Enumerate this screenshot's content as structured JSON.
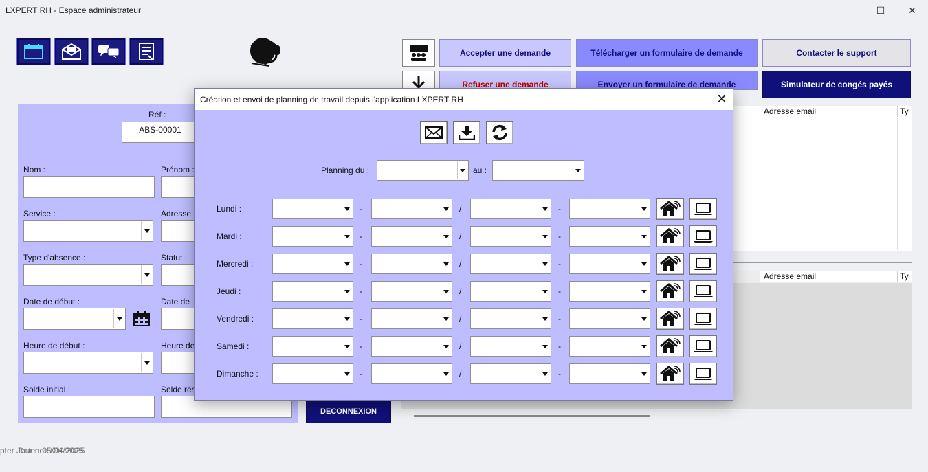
{
  "window": {
    "title": "LXPERT RH - Espace administrateur",
    "minimize": "—",
    "maximize": "☐",
    "close": "✕"
  },
  "toolbar": {
    "icons": [
      "calendar-icon",
      "mail-icon",
      "chat-icon",
      "document-icon"
    ],
    "support_icon": "headset-icon"
  },
  "actions": {
    "accept": "Accepter une demande",
    "refuse": "Refuser une demande",
    "download_form": "Télécharger un formulaire de demande",
    "send_form": "Envoyer un formulaire de demande",
    "contact_support": "Contacter le support",
    "simulator": "Simulateur de congés payés",
    "logout": "DECONNEXION"
  },
  "form": {
    "ref_label": "Réf :",
    "ref_value": "ABS-00001",
    "nom": "Nom :",
    "prenom": "Prénom :",
    "service": "Service :",
    "adresse": "Adresse",
    "type_absence": "Type d'absence :",
    "statut": "Statut :",
    "date_debut": "Date de début :",
    "date_fin": "Date de",
    "heure_debut": "Heure de début :",
    "heure_fin": "Heure de",
    "solde_initial": "Solde initial :",
    "solde_restant": "Solde rés"
  },
  "lists": {
    "top_headers": [
      "Adresse email",
      "Ty"
    ],
    "bottom_headers": [
      "Adresse email",
      "Ty"
    ]
  },
  "footer": {
    "overlap_text": "pter Jour nos t/04/2025",
    "date_text": "Date : 05/04/2025"
  },
  "modal": {
    "title": "Création et envoi de planning de travail depuis l'application LXPERT RH",
    "close": "✕",
    "planning_du": "Planning du :",
    "au": "au :",
    "days": [
      "Lundi :",
      "Mardi :",
      "Mercredi :",
      "Jeudi :",
      "Vendredi :",
      "Samedi :",
      "Dimanche :"
    ],
    "sep_dash": "-",
    "sep_slash": "/"
  },
  "colors": {
    "panel": "#bdbdff",
    "navy": "#10107a",
    "light_button": "#c8c8ff",
    "mid_button": "#8a8aff",
    "refuse_text": "#c00000"
  }
}
